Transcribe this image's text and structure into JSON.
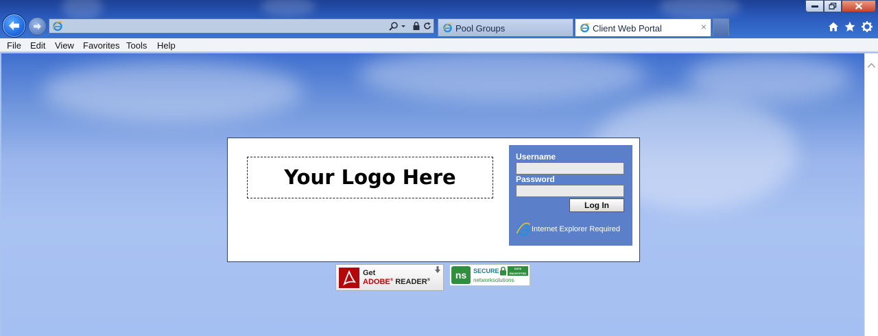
{
  "browser": {
    "address": "",
    "tabs": [
      {
        "label": "Pool Groups",
        "active": false
      },
      {
        "label": "Client Web Portal",
        "active": true
      }
    ],
    "tab_close": "×",
    "menu": [
      "File",
      "Edit",
      "View",
      "Favorites",
      "Tools",
      "Help"
    ],
    "icons": {
      "back": "back-arrow-icon",
      "forward": "forward-arrow-icon",
      "search": "search-icon",
      "lock": "lock-icon",
      "refresh": "refresh-icon",
      "home": "home-icon",
      "favorites": "star-icon",
      "tools": "gear-icon"
    },
    "colors": {
      "chrome": "#2a5bbd",
      "page_sky": "#a9c2f2",
      "login_panel": "#5b7fc8"
    }
  },
  "page": {
    "logo_placeholder": "Your Logo Here",
    "login": {
      "username_label": "Username",
      "username_value": "",
      "password_label": "Password",
      "password_value": "",
      "login_button": "Log In",
      "ie_notice": "Internet Explorer Required"
    },
    "badges": {
      "adobe_get": "Get",
      "adobe_brand": "ADOBE",
      "adobe_reader": "READER",
      "secure_label": "SECURE",
      "secure_tag": "DATA ENCRYPTED",
      "secure_provider": "networksolutions"
    }
  }
}
